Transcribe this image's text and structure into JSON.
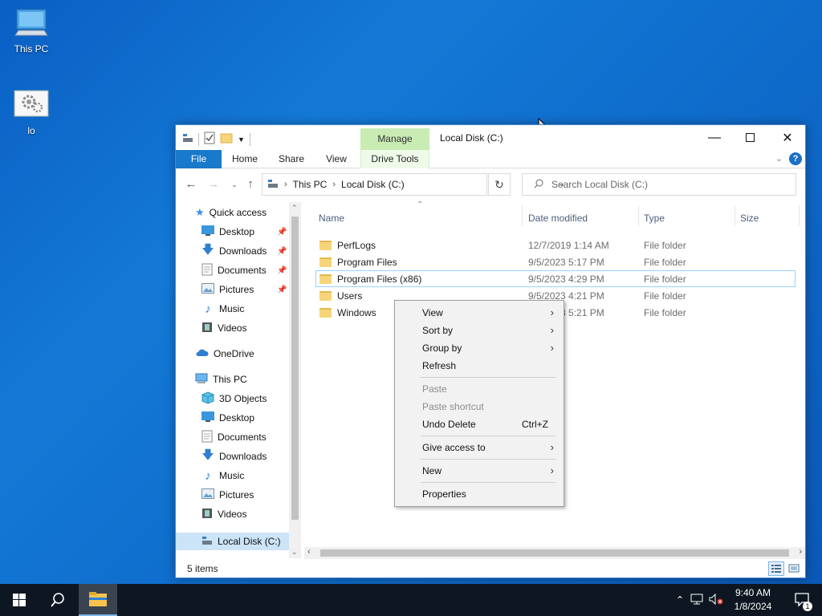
{
  "desktop": {
    "icons": [
      {
        "label": "This PC",
        "icon": "computer-icon"
      },
      {
        "label": "lo",
        "icon": "settings-shortcut-icon"
      }
    ]
  },
  "window": {
    "title": "Local Disk (C:)",
    "contextual_tab_group": "Manage",
    "ribbon_tabs": [
      "File",
      "Home",
      "Share",
      "View",
      "Drive Tools"
    ],
    "address": {
      "segments": [
        "This PC",
        "Local Disk (C:)"
      ]
    },
    "search_placeholder": "Search Local Disk (C:)",
    "status": "5 items"
  },
  "nav_pane": {
    "quick_access": "Quick access",
    "quick_access_items": [
      "Desktop",
      "Downloads",
      "Documents",
      "Pictures",
      "Music",
      "Videos"
    ],
    "onedrive": "OneDrive",
    "this_pc": "This PC",
    "this_pc_items": [
      "3D Objects",
      "Desktop",
      "Documents",
      "Downloads",
      "Music",
      "Pictures",
      "Videos",
      "Local Disk (C:)"
    ]
  },
  "file_list": {
    "columns": [
      "Name",
      "Date modified",
      "Type",
      "Size"
    ],
    "rows": [
      {
        "name": "PerfLogs",
        "date": "12/7/2019 1:14 AM",
        "type": "File folder"
      },
      {
        "name": "Program Files",
        "date": "9/5/2023 5:17 PM",
        "type": "File folder"
      },
      {
        "name": "Program Files (x86)",
        "date": "9/5/2023 4:29 PM",
        "type": "File folder"
      },
      {
        "name": "Users",
        "date": "9/5/2023 4:21 PM",
        "type": "File folder"
      },
      {
        "name": "Windows",
        "date": "9/5/2023 5:21 PM",
        "type": "File folder"
      }
    ]
  },
  "context_menu": {
    "view": "View",
    "sort_by": "Sort by",
    "group_by": "Group by",
    "refresh": "Refresh",
    "paste": "Paste",
    "paste_shortcut": "Paste shortcut",
    "undo_delete": "Undo Delete",
    "undo_shortcut": "Ctrl+Z",
    "give_access": "Give access to",
    "new": "New",
    "properties": "Properties"
  },
  "taskbar": {
    "time": "9:40 AM",
    "date": "1/8/2024",
    "notification_count": "1"
  },
  "colors": {
    "desktop_blue": "#0f6dcc",
    "file_tab_blue": "#1979ca",
    "manage_green": "#c8ecb3",
    "selection_blue": "#cce4f7",
    "taskbar_dark": "#0d1621"
  }
}
